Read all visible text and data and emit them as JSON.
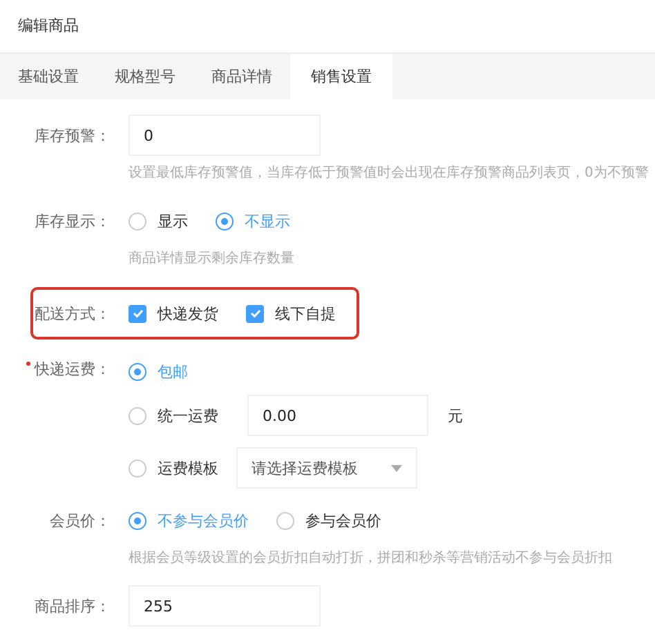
{
  "title": "编辑商品",
  "tabs": [
    {
      "label": "基础设置",
      "selected": false
    },
    {
      "label": "规格型号",
      "selected": false
    },
    {
      "label": "商品详情",
      "selected": false
    },
    {
      "label": "销售设置",
      "selected": true
    }
  ],
  "fields": [
    {
      "kind": "input",
      "label": "库存预警：",
      "value": "0",
      "hint": "设置最低库存预警值，当库存低于预警值时会出现在库存预警商品列表页，0为不预警"
    },
    {
      "kind": "radio",
      "label": "库存显示：",
      "options": [
        {
          "label": "显示",
          "selected": false
        },
        {
          "label": "不显示",
          "selected": true
        }
      ],
      "hint": "商品详情显示剩余库存数量"
    },
    {
      "kind": "checkbox",
      "label": "配送方式：",
      "highlighted": true,
      "options": [
        {
          "label": "快递发货",
          "checked": true
        },
        {
          "label": "线下自提",
          "checked": true
        }
      ]
    },
    {
      "kind": "shipping",
      "label": "快递运费：",
      "required": true,
      "options": [
        {
          "kind": "plain",
          "label": "包邮",
          "selected": true
        },
        {
          "kind": "input",
          "label": "统一运费",
          "selected": false,
          "value": "0.00",
          "unit": "元"
        },
        {
          "kind": "select",
          "label": "运费模板",
          "selected": false,
          "placeholder": "请选择运费模板"
        }
      ]
    },
    {
      "kind": "radio",
      "label": "会员价：",
      "options": [
        {
          "label": "不参与会员价",
          "selected": true
        },
        {
          "label": "参与会员价",
          "selected": false
        }
      ],
      "hint": "根据会员等级设置的会员折扣自动打折，拼团和秒杀等营销活动不参与会员折扣"
    },
    {
      "kind": "input",
      "label": "商品排序：",
      "value": "255"
    }
  ]
}
